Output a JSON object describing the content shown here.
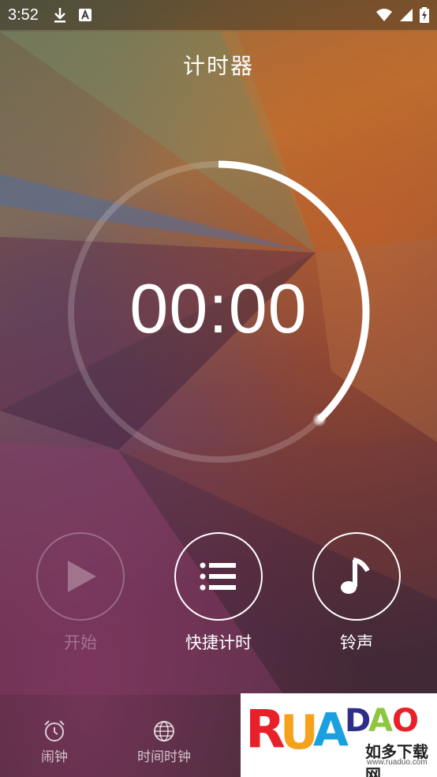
{
  "status_bar": {
    "time": "3:52",
    "left_icons": [
      "download-icon",
      "a-notification-icon"
    ],
    "right_icons": [
      "wifi-icon",
      "signal-icon",
      "battery-charging-icon"
    ]
  },
  "header": {
    "title": "计时器"
  },
  "timer": {
    "display": "00:00",
    "progress": 0.38,
    "accent_color": "#ffffff"
  },
  "controls": [
    {
      "label": "开始",
      "icon": "play-icon",
      "enabled": false
    },
    {
      "label": "快捷计时",
      "icon": "list-icon",
      "enabled": true
    },
    {
      "label": "铃声",
      "icon": "music-note-icon",
      "enabled": true
    }
  ],
  "bottom_nav": [
    {
      "label": "闹钟",
      "icon": "alarm-clock-icon"
    },
    {
      "label": "时间时钟",
      "icon": "globe-icon"
    }
  ],
  "watermark": {
    "letters": [
      "R",
      "U",
      "A",
      "D",
      "A",
      "O"
    ],
    "brand_cn": "如多下载网",
    "url": "www.ruaduo.com",
    "colors": [
      "#e8202a",
      "#f6a11a",
      "#1aa0e0",
      "#2e2e87",
      "#8dc63f",
      "#e8202a"
    ]
  }
}
